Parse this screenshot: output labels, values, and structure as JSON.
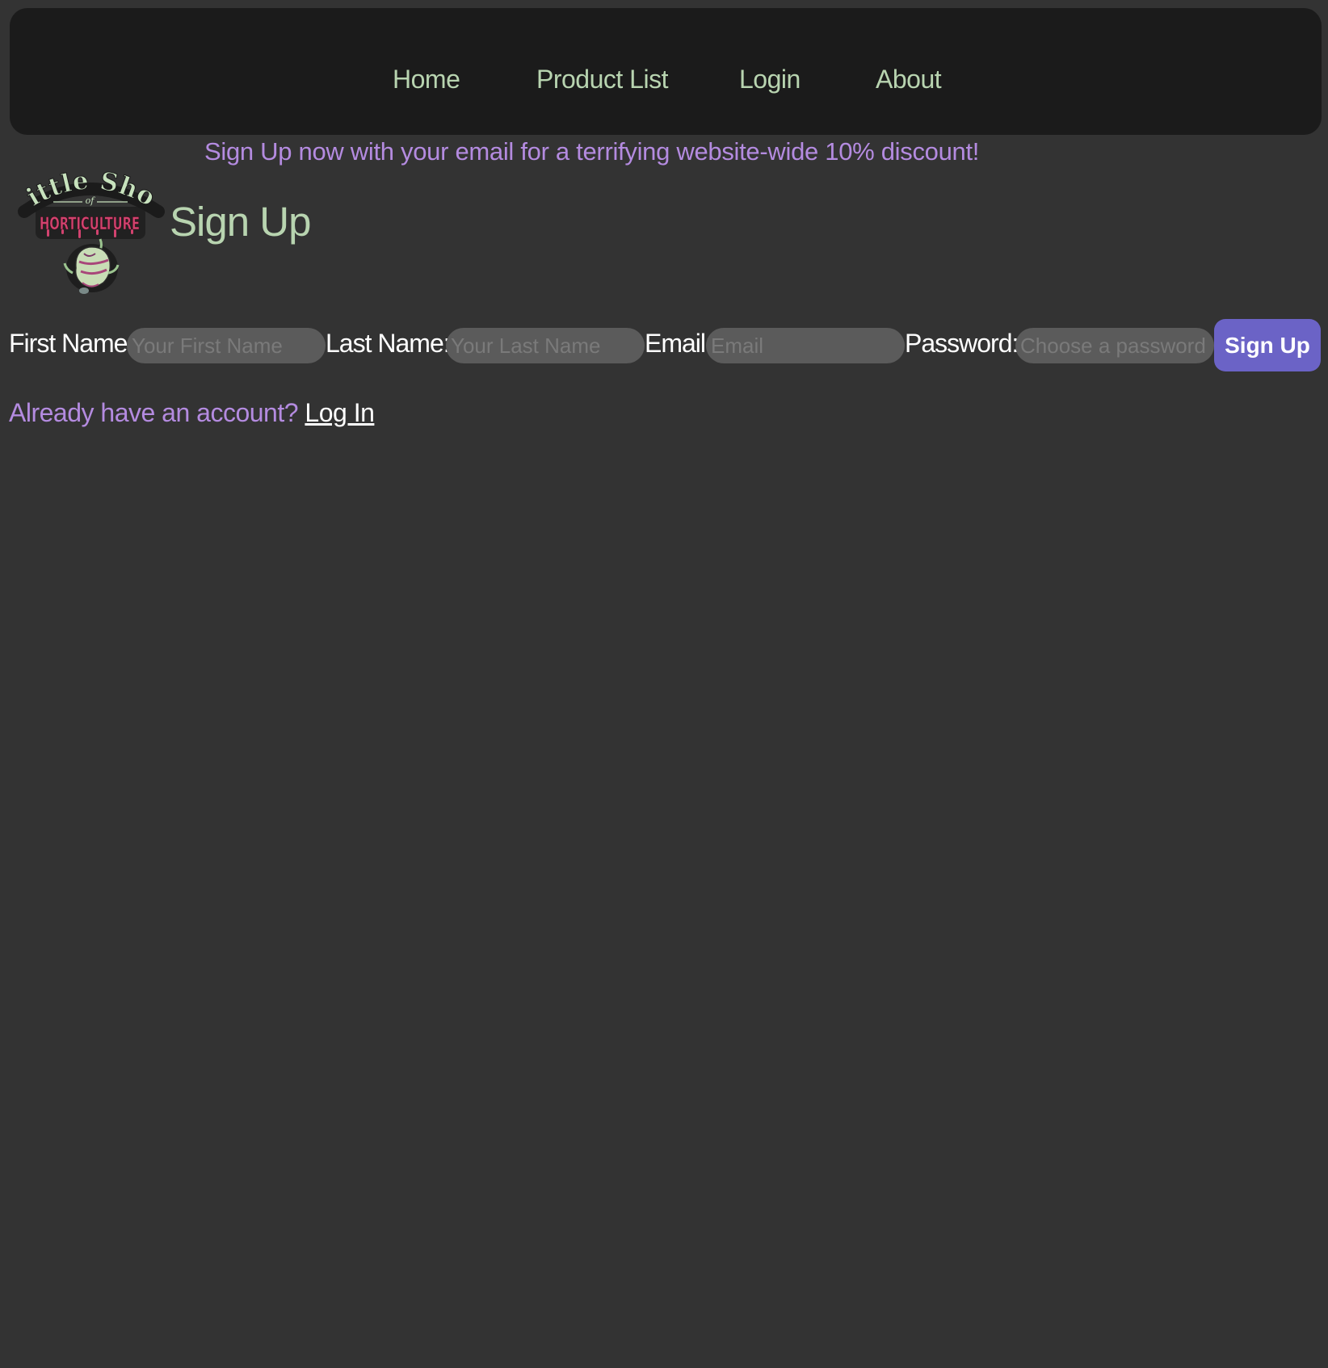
{
  "nav": {
    "items": [
      {
        "label": "Home"
      },
      {
        "label": "Product List"
      },
      {
        "label": "Login"
      },
      {
        "label": "About"
      }
    ]
  },
  "promo": {
    "text": "Sign Up now with your email for a terrifying website-wide 10% discount!"
  },
  "logo": {
    "line1": "Little Shop",
    "line2": "of",
    "line3": "HORTICULTURE",
    "icon": "venus-flytrap-plant-icon"
  },
  "page": {
    "title": "Sign Up"
  },
  "form": {
    "first_name": {
      "label": "First Name:",
      "placeholder": "Your First Name"
    },
    "last_name": {
      "label": "Last Name:",
      "placeholder": "Your Last Name"
    },
    "email": {
      "label": "Email:",
      "placeholder": "Email"
    },
    "password": {
      "label": "Password:",
      "placeholder": "Choose a password (i"
    },
    "submit_label": "Sign Up"
  },
  "account": {
    "prompt": "Already have an account?",
    "login_link": "Log In"
  },
  "colors": {
    "background": "#333333",
    "navbar": "#1b1b1b",
    "green_text": "#b8d4b0",
    "purple_text": "#b48be0",
    "button": "#6b63c6",
    "input_bg": "#5b5b5b",
    "logo_pink": "#d2436f"
  }
}
